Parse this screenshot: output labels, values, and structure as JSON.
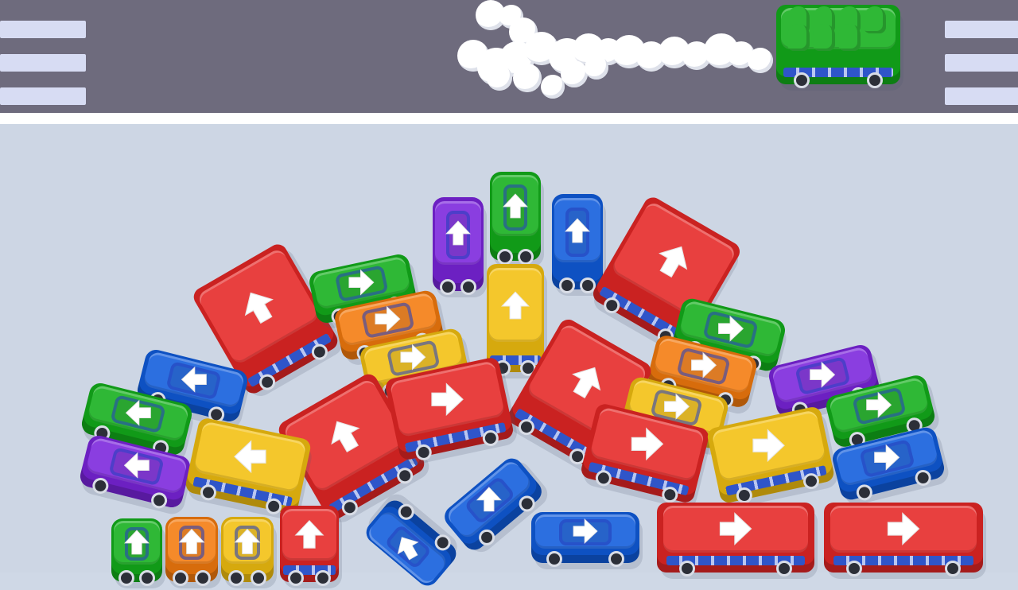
{
  "colors": {
    "red": "#e8403f",
    "green": "#2fb836",
    "blue": "#2c6fe0",
    "yellow": "#f4c72c",
    "orange": "#f58a2a",
    "purple": "#8a3ee0",
    "road": "#6e6b7d",
    "lot": "#cdd6e4"
  },
  "icons": {
    "direction_arrow": "arrow-icon",
    "exhaust_smoke": "smoke-icon",
    "passenger": "passenger-icon"
  },
  "departing_vehicle": {
    "type": "bus",
    "color": "green",
    "passengers": 7,
    "direction": "right"
  },
  "lot_vehicles": [
    {
      "type": "car",
      "color": "purple",
      "direction": "up"
    },
    {
      "type": "car",
      "color": "green",
      "direction": "up"
    },
    {
      "type": "car",
      "color": "blue",
      "direction": "up"
    },
    {
      "type": "bus",
      "color": "red",
      "direction": "up-right"
    },
    {
      "type": "bus",
      "color": "red",
      "direction": "up-left"
    },
    {
      "type": "car",
      "color": "green",
      "direction": "right"
    },
    {
      "type": "car",
      "color": "orange",
      "direction": "right"
    },
    {
      "type": "bus",
      "color": "yellow",
      "direction": "up"
    },
    {
      "type": "car",
      "color": "yellow",
      "direction": "right"
    },
    {
      "type": "car",
      "color": "green",
      "direction": "right"
    },
    {
      "type": "car",
      "color": "orange",
      "direction": "right"
    },
    {
      "type": "car",
      "color": "purple",
      "direction": "right"
    },
    {
      "type": "car",
      "color": "blue",
      "direction": "left"
    },
    {
      "type": "bus",
      "color": "red",
      "direction": "up-left"
    },
    {
      "type": "bus",
      "color": "red",
      "direction": "right"
    },
    {
      "type": "bus",
      "color": "red",
      "direction": "up-right"
    },
    {
      "type": "car",
      "color": "yellow",
      "direction": "right"
    },
    {
      "type": "car",
      "color": "green",
      "direction": "right"
    },
    {
      "type": "car",
      "color": "green",
      "direction": "left"
    },
    {
      "type": "car",
      "color": "purple",
      "direction": "left"
    },
    {
      "type": "bus",
      "color": "yellow",
      "direction": "left"
    },
    {
      "type": "bus",
      "color": "red",
      "direction": "right"
    },
    {
      "type": "bus",
      "color": "yellow",
      "direction": "right"
    },
    {
      "type": "car",
      "color": "blue",
      "direction": "right"
    },
    {
      "type": "car",
      "color": "blue",
      "direction": "right"
    },
    {
      "type": "car",
      "color": "blue",
      "direction": "up"
    },
    {
      "type": "car",
      "color": "blue",
      "direction": "up-left"
    },
    {
      "type": "car",
      "color": "blue",
      "direction": "right"
    },
    {
      "type": "bus",
      "color": "red",
      "direction": "right"
    },
    {
      "type": "bus",
      "color": "red",
      "direction": "right"
    },
    {
      "type": "car",
      "color": "green",
      "direction": "up"
    },
    {
      "type": "car",
      "color": "orange",
      "direction": "up"
    },
    {
      "type": "car",
      "color": "yellow",
      "direction": "up"
    },
    {
      "type": "bus",
      "color": "red",
      "direction": "up"
    }
  ]
}
